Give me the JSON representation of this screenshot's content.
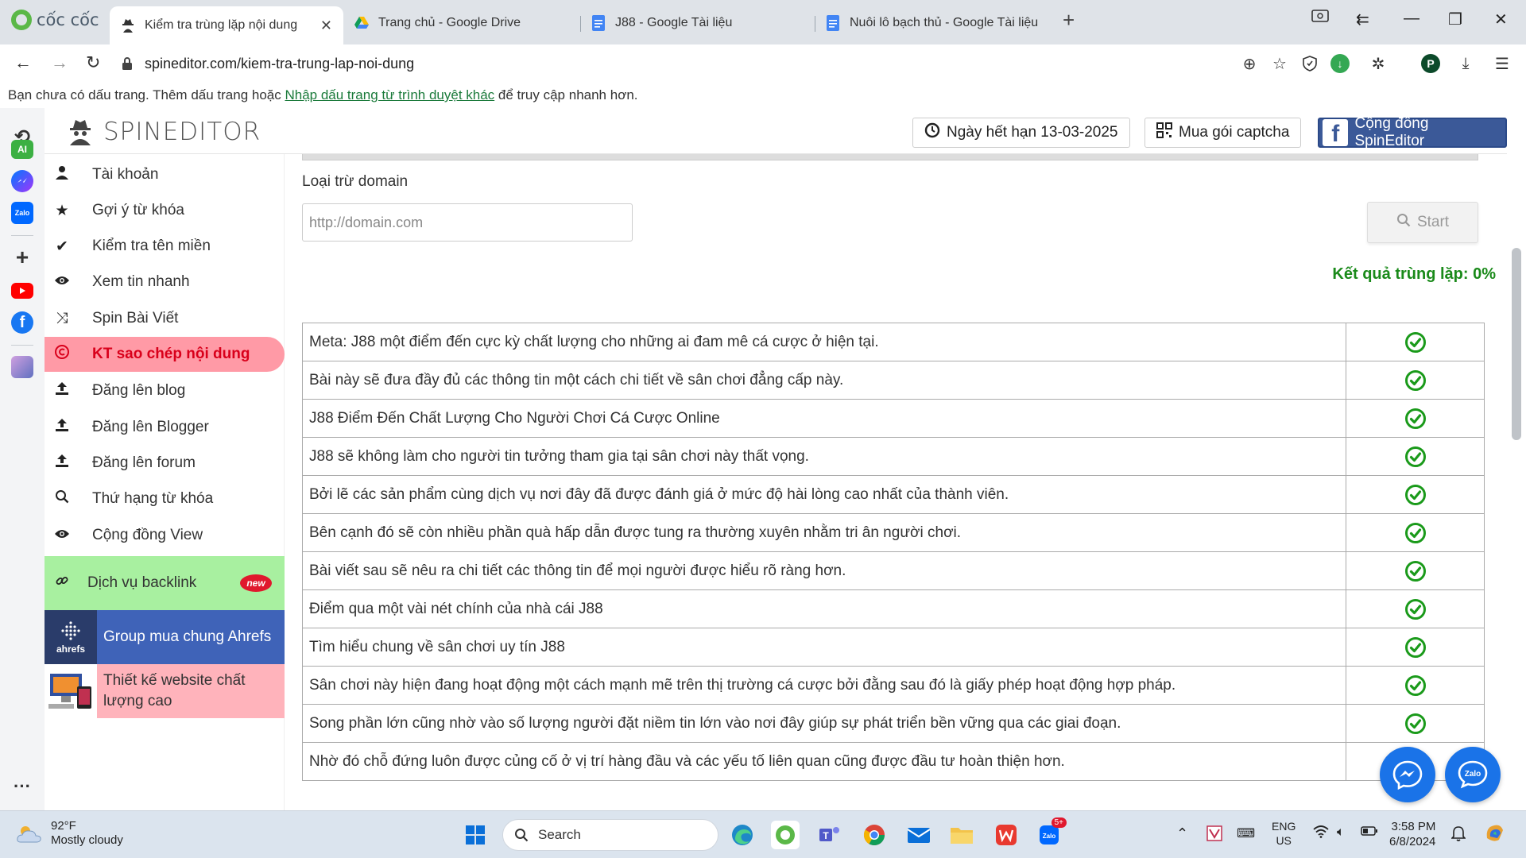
{
  "browser": {
    "brand": "cốc cốc",
    "tabs": [
      {
        "title": "Kiểm tra trùng lặp nội dung",
        "active": true
      },
      {
        "title": "Trang chủ - Google Drive",
        "active": false
      },
      {
        "title": "J88 - Google Tài liệu",
        "active": false
      },
      {
        "title": "Nuôi lô bạch thủ - Google Tài liệu",
        "active": false
      }
    ],
    "url": "spineditor.com/kiem-tra-trung-lap-noi-dung",
    "bookmark_bar": {
      "text_before": "Bạn chưa có dấu trang. Thêm dấu trang hoặc ",
      "link": "Nhập dấu trang từ trình duyệt khác",
      "text_after": " để truy cập nhanh hơn."
    },
    "profile_initial": "P"
  },
  "rail": {
    "ai_label": "AI",
    "zalo_label": "Zalo"
  },
  "header": {
    "logo_text": "SPINEDITOR",
    "expiry": "Ngày hết hạn 13-03-2025",
    "captcha": "Mua gói captcha",
    "community": "Cộng đồng SpinEditor"
  },
  "sidebar": {
    "items": [
      {
        "label": "Tài khoản",
        "icon": "user-icon"
      },
      {
        "label": "Gợi ý từ khóa",
        "icon": "star-icon"
      },
      {
        "label": "Kiểm tra tên miền",
        "icon": "check-icon"
      },
      {
        "label": "Xem tin nhanh",
        "icon": "eye-icon"
      },
      {
        "label": "Spin Bài Viết",
        "icon": "shuffle-icon"
      },
      {
        "label": "KT sao chép nội dung",
        "icon": "copyright-icon",
        "active": true
      },
      {
        "label": "Đăng lên blog",
        "icon": "upload-icon"
      },
      {
        "label": "Đăng lên Blogger",
        "icon": "upload-icon"
      },
      {
        "label": "Đăng lên forum",
        "icon": "upload-icon"
      },
      {
        "label": "Thứ hạng từ khóa",
        "icon": "search-icon"
      },
      {
        "label": "Cộng đồng View",
        "icon": "eye-icon"
      }
    ],
    "backlink": {
      "label": "Dịch vụ backlink",
      "badge": "new"
    },
    "promo_ahrefs": {
      "label": "Group mua chung Ahrefs",
      "logo": "ahrefs"
    },
    "promo_website": {
      "label": "Thiết kế website chất lượng cao"
    }
  },
  "form": {
    "exclude_label": "Loại trừ domain",
    "domain_placeholder": "http://domain.com",
    "start_label": "Start",
    "result": "Kết quả trùng lặp: 0%"
  },
  "results": [
    "Meta: J88 một điểm đến cực kỳ chất lượng cho những ai đam mê cá cược ở hiện tại.",
    "Bài này sẽ đưa đầy đủ các thông tin một cách chi tiết về sân chơi đẳng cấp này.",
    "J88 Điểm Đến Chất Lượng Cho Người Chơi Cá Cược Online",
    "J88 sẽ không làm cho người tin tưởng tham gia tại sân chơi này thất vọng.",
    "Bởi lẽ các sản phẩm cùng dịch vụ nơi đây đã được đánh giá ở mức độ hài lòng cao nhất của thành viên.",
    "Bên cạnh đó sẽ còn nhiều phần quà hấp dẫn được tung ra thường xuyên nhằm tri ân người chơi.",
    "Bài viết sau sẽ nêu ra chi tiết các thông tin để mọi người được hiểu rõ ràng hơn.",
    "Điểm qua một vài nét chính của nhà cái J88",
    "Tìm hiểu chung về sân chơi uy tín J88",
    "Sân chơi này hiện đang hoạt động một cách mạnh mẽ trên thị trường cá cược bởi đằng sau đó là giấy phép hoạt động hợp pháp.",
    "Song phần lớn cũng nhờ vào số lượng người đặt niềm tin lớn vào nơi đây giúp sự phát triển bền vững qua các giai đoạn.",
    "Nhờ đó chỗ đứng luôn được củng cố ở vị trí hàng đầu và các yếu tố liên quan cũng được đầu tư hoàn thiện hơn."
  ],
  "taskbar": {
    "temp": "92°F",
    "weather": "Mostly cloudy",
    "search": "Search",
    "teams_badge": "5+",
    "lang1": "ENG",
    "lang2": "US",
    "time": "3:58 PM",
    "date": "6/8/2024"
  },
  "colors": {
    "active_menu_bg": "#ff9aa6",
    "active_menu_text": "#d9001b",
    "backlink_bg": "#a8f0a0",
    "ahrefs_bg": "#3f63b8",
    "website_bg": "#ffb3bb",
    "result_green": "#1a8a1a",
    "check_green": "#1a9a1a",
    "facebook_blue": "#3b5998"
  }
}
